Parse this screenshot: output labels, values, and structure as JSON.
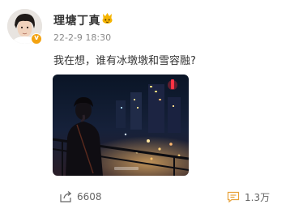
{
  "post": {
    "author": {
      "name": "理塘丁真",
      "verified": true
    },
    "timestamp": "22-2-9 18:30",
    "text": "我在想，谁有冰墩墩和雪容融?",
    "image_alt": "夜景照片",
    "actions": {
      "repost_count": "6608",
      "comment_count": "1.3万"
    }
  },
  "colors": {
    "verified_badge": "#f3a312",
    "fan_badge": "#f5b400",
    "text": "#333333",
    "meta": "#8a8a8a"
  },
  "icons": {
    "repost": "share-icon",
    "comment": "comment-icon",
    "verified": "verified-badge-icon",
    "fan": "fan-badge-icon"
  }
}
